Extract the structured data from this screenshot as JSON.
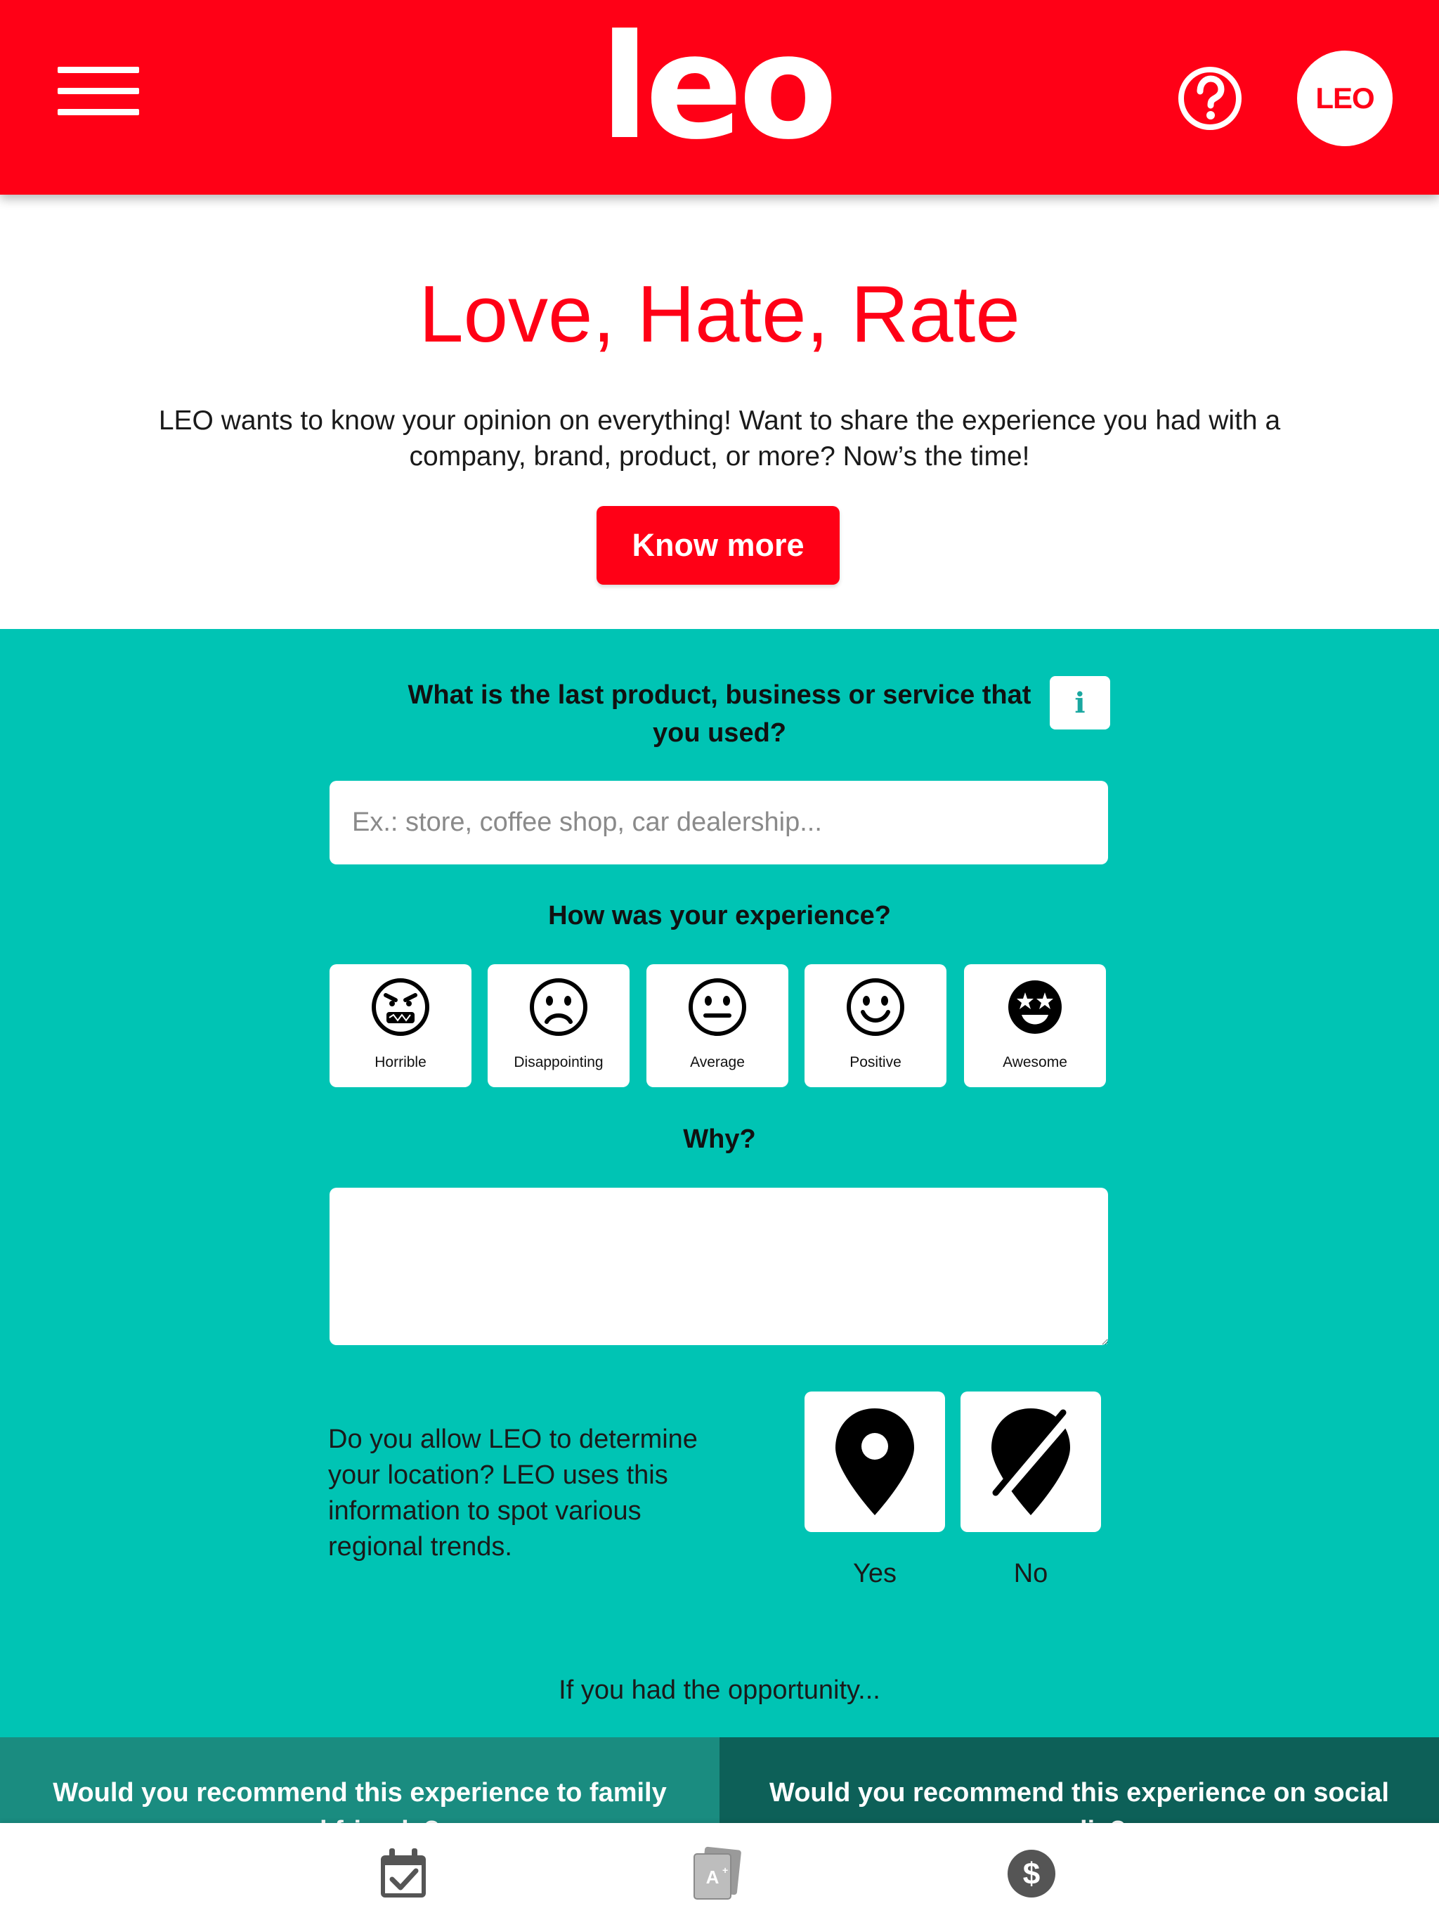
{
  "colors": {
    "brand": "#ff0016",
    "teal": "#00c4b4",
    "teal_mid": "#1a8c80",
    "teal_dark": "#0d6058"
  },
  "header": {
    "menu_icon": "hamburger-menu-icon",
    "logo_text": "LEO",
    "help_icon": "question-circle-icon",
    "avatar_text": "LEO"
  },
  "hero": {
    "title": "Love, Hate, Rate",
    "description": "LEO wants to know your opinion on everything! Want to share the experience you had with a company, brand, product, or more? Now’s the time!",
    "know_more_label": "Know more"
  },
  "form": {
    "question_product": "What is the last product, business or service that you used?",
    "info_icon": "info-icon",
    "info_label": "i",
    "product_placeholder": "Ex.: store, coffee shop, car dealership...",
    "product_value": "",
    "question_experience": "How was your experience?",
    "ratings": [
      {
        "label": "Horrible",
        "icon": "angry-face-icon"
      },
      {
        "label": "Disappointing",
        "icon": "frowning-face-icon"
      },
      {
        "label": "Average",
        "icon": "neutral-face-icon"
      },
      {
        "label": "Positive",
        "icon": "smiling-face-icon"
      },
      {
        "label": "Awesome",
        "icon": "star-eyes-face-icon"
      }
    ],
    "question_why": "Why?",
    "why_value": "",
    "location_question": "Do you allow LEO to determine your location? LEO uses this information to spot various regional trends.",
    "location_yes": "Yes",
    "location_no": "No",
    "opportunity_text": "If you had the opportunity...",
    "recommend_family": "Would you recommend this experience to family and friends?",
    "recommend_social": "Would you recommend this experience on social media?"
  },
  "bottom_nav": {
    "items": [
      {
        "icon": "calendar-check-icon"
      },
      {
        "icon": "cards-grade-icon"
      },
      {
        "icon": "dollar-coin-icon"
      }
    ]
  }
}
